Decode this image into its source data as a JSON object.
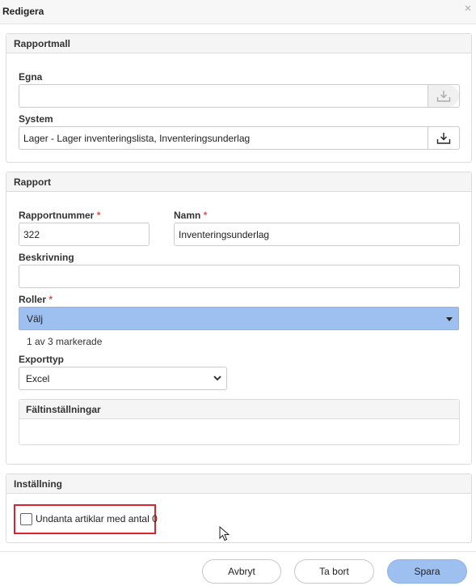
{
  "dialog": {
    "title": "Redigera",
    "close_symbol": "×"
  },
  "rapportmall": {
    "header": "Rapportmall",
    "egna": {
      "label": "Egna",
      "value": ""
    },
    "system": {
      "label": "System",
      "value": "Lager - Lager inventeringslista, Inventeringsunderlag"
    }
  },
  "rapport": {
    "header": "Rapport",
    "rapportnummer": {
      "label": "Rapportnummer",
      "required_mark": "*",
      "value": "322"
    },
    "namn": {
      "label": "Namn",
      "required_mark": "*",
      "value": "Inventeringsunderlag"
    },
    "beskrivning": {
      "label": "Beskrivning",
      "value": ""
    },
    "roller": {
      "label": "Roller",
      "required_mark": "*",
      "selected": "Välj",
      "count_text": "1 av 3 markerade"
    },
    "exporttyp": {
      "label": "Exporttyp",
      "selected": "Excel"
    },
    "faltinstallningar": {
      "header": "Fältinställningar"
    }
  },
  "installning": {
    "header": "Inställning",
    "checkbox_label": "Undanta artiklar med antal 0",
    "checked": false
  },
  "footer": {
    "cancel": "Avbryt",
    "delete": "Ta bort",
    "save": "Spara"
  },
  "colors": {
    "primary": "#9ec0f0",
    "required": "#d9534f",
    "highlight_border": "#d9232e"
  },
  "icons": {
    "download": "download-tray-icon",
    "close": "close-icon",
    "dropdown": "caret-down-icon"
  }
}
